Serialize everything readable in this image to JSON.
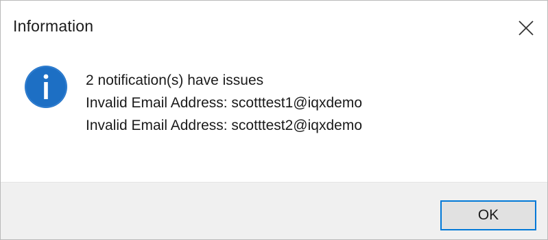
{
  "window": {
    "title": "Information",
    "close_icon": "close-icon"
  },
  "message": {
    "icon": "info-icon",
    "lines": [
      "2 notification(s) have issues",
      "Invalid Email Address: scotttest1@iqxdemo",
      "Invalid Email Address: scotttest2@iqxdemo"
    ]
  },
  "buttons": {
    "ok_label": "OK"
  },
  "colors": {
    "accent": "#0078d7",
    "icon_blue": "#1d6fc4",
    "footer_bg": "#f0f0f0",
    "button_bg": "#e1e1e1"
  }
}
